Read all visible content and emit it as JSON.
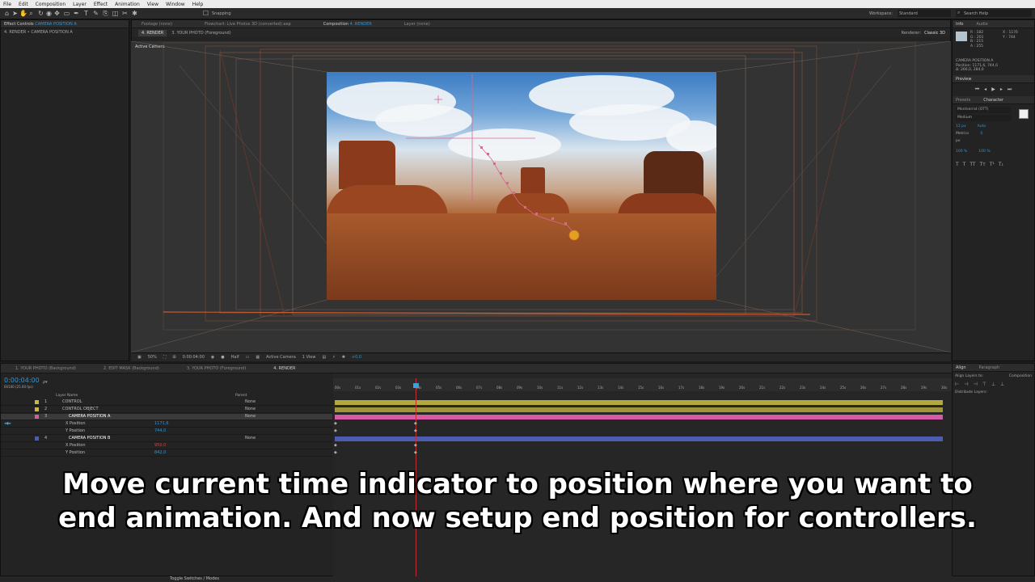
{
  "menu": [
    "File",
    "Edit",
    "Composition",
    "Layer",
    "Effect",
    "Animation",
    "View",
    "Window",
    "Help"
  ],
  "toolbar": {
    "snapping": "Snapping",
    "workspace_label": "Workspace:",
    "workspace_value": "Standard",
    "search_help": "Search Help"
  },
  "effect_controls": {
    "tab": "Effect Controls",
    "layer": "CAMERA POSITION A",
    "breadcrumb": "4. RENDER • CAMERA POSITION A"
  },
  "comp_tabs": {
    "footage": "Footage (none)",
    "project": "Flowchart: Live Photos 3D (converted).aep",
    "composition": "Composition",
    "comp_name": "4. RENDER",
    "layer": "Layer (none)"
  },
  "comp_sub": {
    "render": "4. RENDER",
    "photo": "3. YOUR PHOTO (Foreground)",
    "renderer_label": "Renderer:",
    "renderer": "Classic 3D",
    "active_camera": "Active Camera"
  },
  "viewer_footer": {
    "zoom": "50%",
    "timecode": "0:00:04:00",
    "resolution": "Half",
    "camera": "Active Camera",
    "views": "1 View",
    "exposure": "+0,0"
  },
  "info": {
    "tab_info": "Info",
    "tab_audio": "Audio",
    "r": "R : 182",
    "g": "G : 201",
    "b": "B : 215",
    "a": "A : 255",
    "x": "X : 1176",
    "y": "Y : 744",
    "layer": "CAMERA POSITION A",
    "position": "Position: 1171,6, 744,0",
    "delta": "Δ: 266,0, 284,0"
  },
  "preview": {
    "tab": "Preview"
  },
  "character": {
    "tab_presets": "Presets",
    "tab_character": "Character",
    "font": "Montserrat (OTT)",
    "style": "Medium",
    "size": "12 px",
    "leading": "Auto",
    "tracking": "0",
    "unit": "px",
    "vscale": "100 %",
    "hscale": "100 %",
    "kern": "Metrics"
  },
  "timeline_tabs": [
    "1. YOUR PHOTO (Background)",
    "2. EDIT MASK (Background)",
    "3. YOUR PHOTO (Foreground)",
    "4. RENDER"
  ],
  "timeline": {
    "timecode": "0:00:04:00",
    "frames": "00100 (25.00 fps)",
    "search_placeholder": "ρ▾",
    "col_layer": "Layer Name",
    "col_parent": "Parent",
    "layers": [
      {
        "num": "1",
        "name": "CONTROL",
        "parent": "None"
      },
      {
        "num": "2",
        "name": "CONTROL OBJECT",
        "parent": "None"
      },
      {
        "num": "3",
        "name": "CAMERA POSITION A",
        "parent": "None"
      },
      {
        "num": "",
        "name": "X Position",
        "value": "1171,6"
      },
      {
        "num": "",
        "name": "Y Position",
        "value": "744,0"
      },
      {
        "num": "4",
        "name": "CAMERA POSITION B",
        "parent": "None"
      },
      {
        "num": "",
        "name": "X Position",
        "value": "950,0"
      },
      {
        "num": "",
        "name": "Y Position",
        "value": "842,0"
      }
    ],
    "ruler": [
      "00s",
      "01s",
      "02s",
      "03s",
      "04s",
      "05s",
      "06s",
      "07s",
      "08s",
      "09s",
      "10s",
      "11s",
      "12s",
      "13s",
      "14s",
      "15s",
      "16s",
      "17s",
      "18s",
      "19s",
      "20s",
      "21s",
      "22s",
      "23s",
      "24s",
      "25s",
      "26s",
      "27s",
      "28s",
      "29s",
      "30s"
    ],
    "toggle": "Toggle Switches / Modes"
  },
  "align": {
    "tab": "Align",
    "tab2": "Paragraph",
    "align_to_label": "Align Layers to:",
    "align_to": "Composition",
    "distribute": "Distribute Layers:"
  },
  "caption": {
    "line1": "Move current time indicator to position where you want to",
    "line2": "end animation.  And now setup end position for controllers."
  },
  "colors": {
    "accent": "#2f95d8",
    "layer_yellow": "#b4aa3c",
    "layer_pink": "#d85aa6",
    "layer_blue": "#4c5db0",
    "playhead": "#3aa0e0"
  }
}
